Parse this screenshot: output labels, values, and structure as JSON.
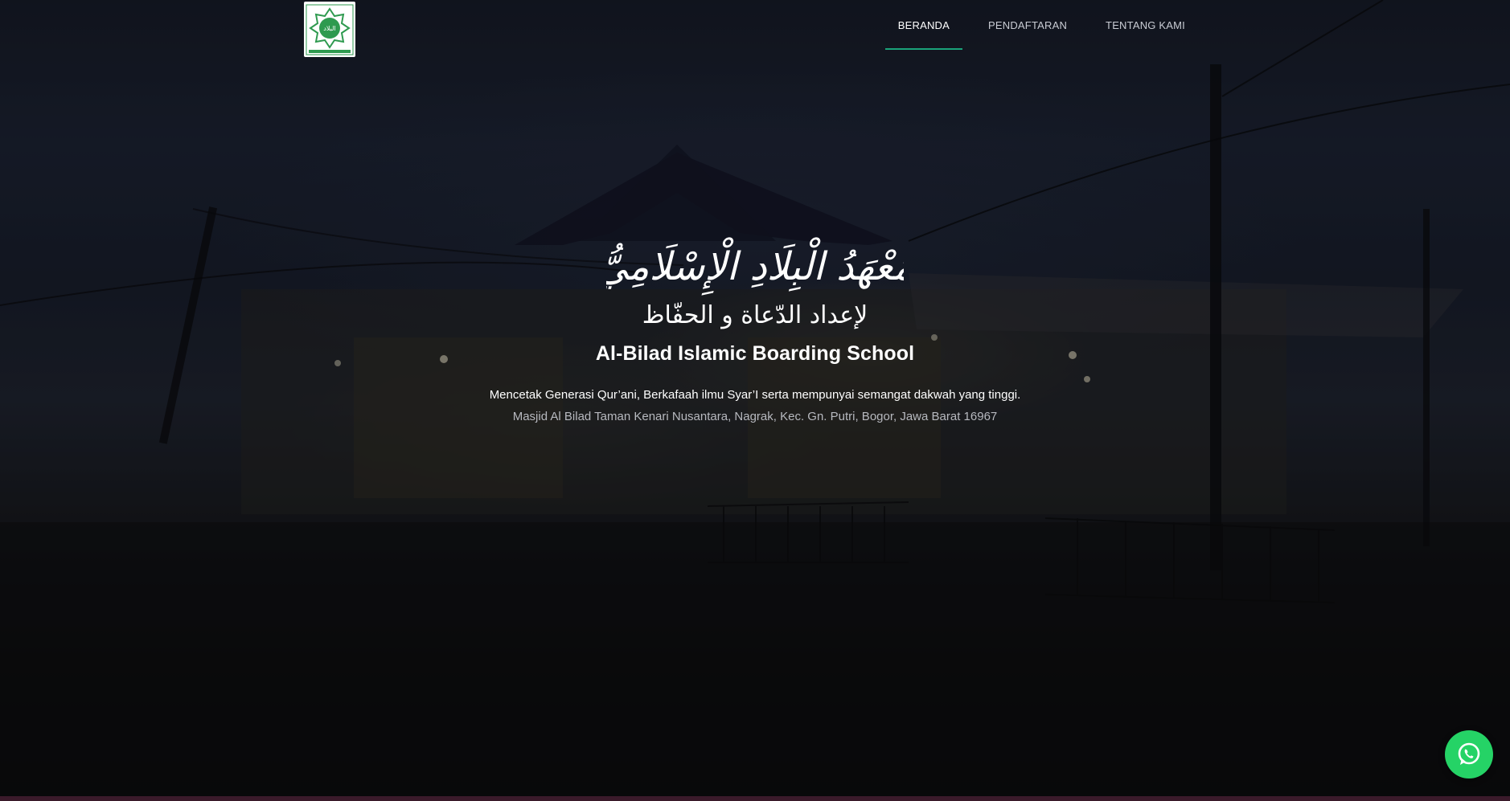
{
  "header": {
    "logo_icon": "al-bilad-emblem-logo",
    "logo_text": "البلاد",
    "nav": [
      {
        "label": "BERANDA",
        "active": true
      },
      {
        "label": "PENDAFTARAN",
        "active": false
      },
      {
        "label": "TENTANG KAMI",
        "active": false
      }
    ],
    "accent_color": "#1aa37a"
  },
  "hero": {
    "arabic_title": "مَعْهَدُ الْبِلَادِ الْإِسْلَامِيُّ",
    "arabic_subtitle": "لإعداد الدّعاة و الحفّاظ",
    "title": "Al-Bilad Islamic Boarding School",
    "tagline": "Mencetak Generasi Qur’ani, Berkafaah ilmu Syar’I serta mempunyai semangat dakwah yang tinggi.",
    "address": "Masjid Al Bilad Taman Kenari Nusantara, Nagrak, Kec. Gn. Putri, Bogor, Jawa Barat 16967"
  },
  "floating": {
    "whatsapp_icon": "whatsapp-icon",
    "whatsapp_color": "#25d366"
  }
}
